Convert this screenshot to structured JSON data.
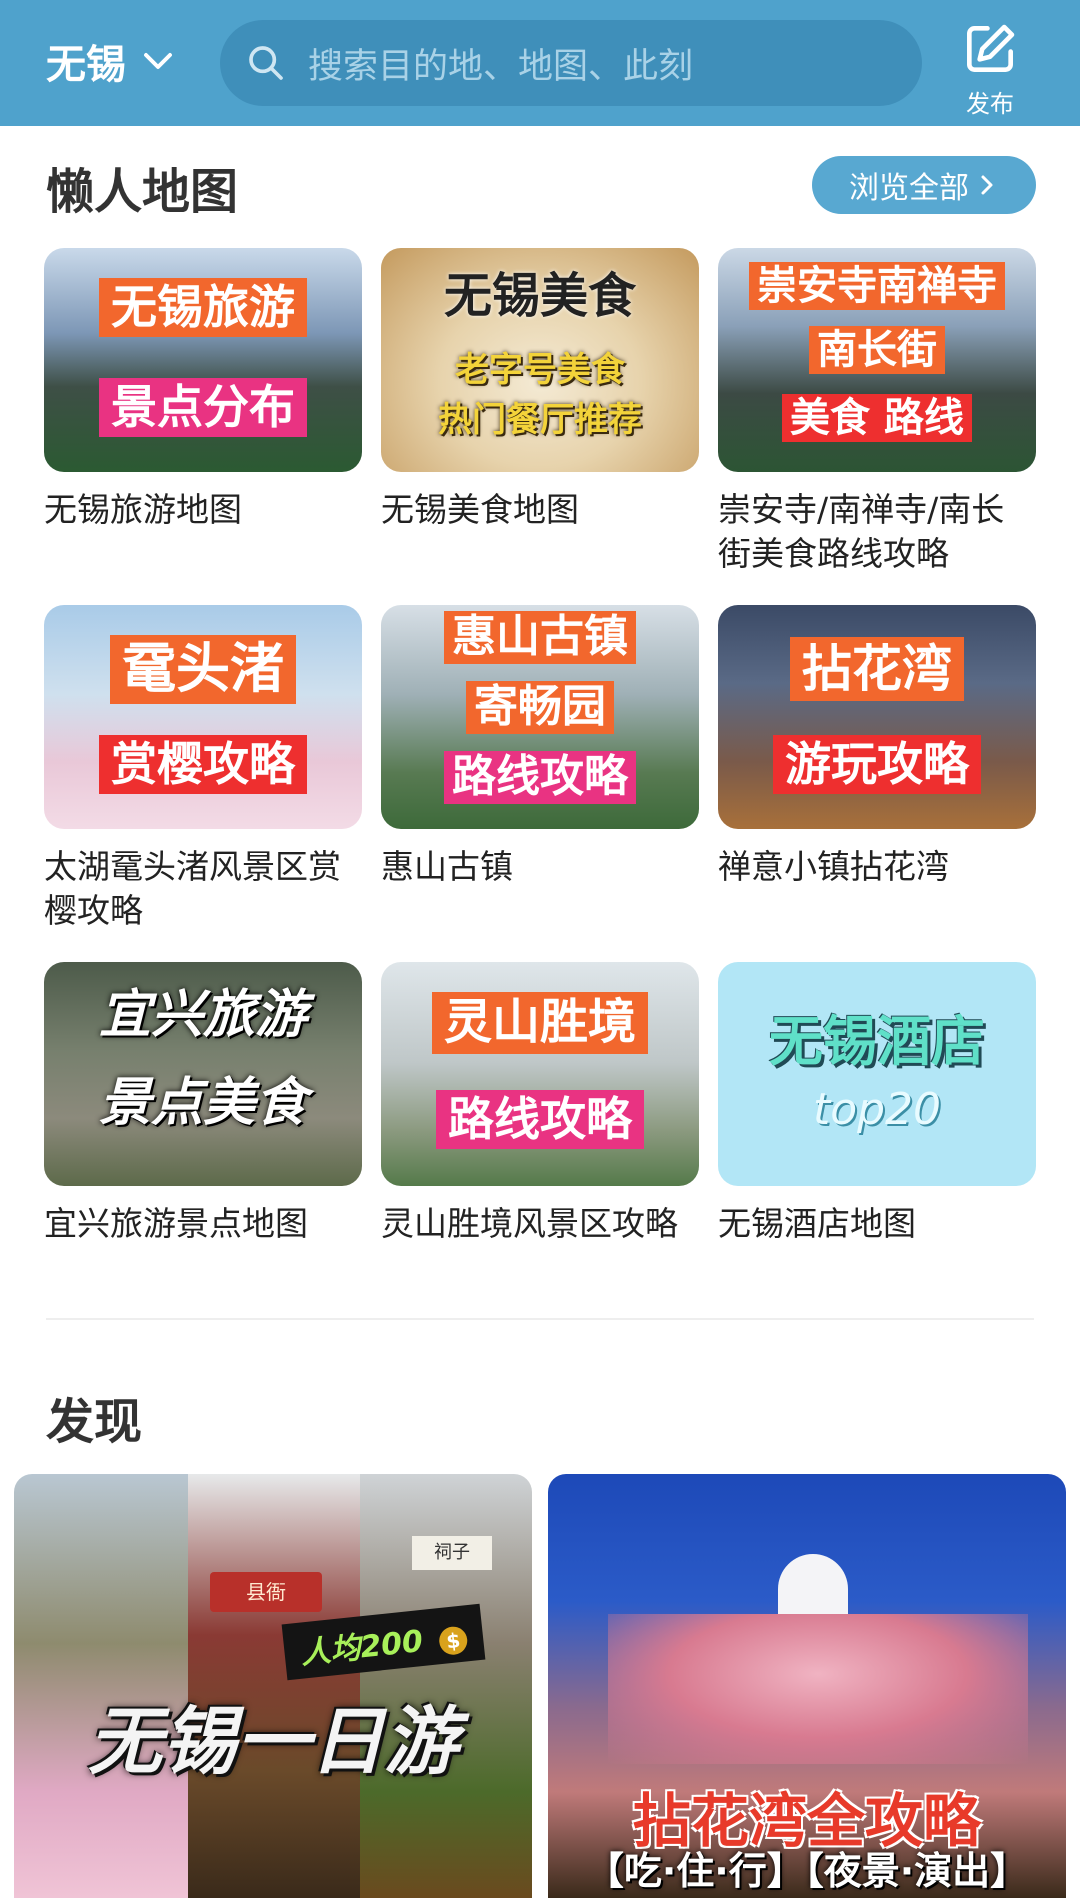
{
  "header": {
    "city": "无锡",
    "search_placeholder": "搜索目的地、地图、此刻",
    "publish_label": "发布"
  },
  "lazy_map": {
    "title": "懒人地图",
    "browse_all_label": "浏览全部",
    "items": [
      {
        "name": "无锡旅游地图",
        "tags": [
          "无锡旅游",
          "景点分布"
        ]
      },
      {
        "name": "无锡美食地图",
        "tags": [
          "无锡美食",
          "老字号美食",
          "热门餐厅推荐"
        ]
      },
      {
        "name": "崇安寺/南禅寺/南长街美食路线攻略",
        "tags": [
          "崇安寺南禅寺",
          "南长街",
          "美食 路线"
        ]
      },
      {
        "name": "太湖鼋头渚风景区赏樱攻略",
        "tags": [
          "鼋头渚",
          "赏樱攻略"
        ]
      },
      {
        "name": "惠山古镇",
        "tags": [
          "惠山古镇",
          "寄畅园",
          "路线攻略"
        ]
      },
      {
        "name": "禅意小镇拈花湾",
        "tags": [
          "拈花湾",
          "游玩攻略"
        ]
      },
      {
        "name": "宜兴旅游景点地图",
        "tags": [
          "宜兴旅游",
          "景点美食"
        ]
      },
      {
        "name": "灵山胜境风景区攻略",
        "tags": [
          "灵山胜境",
          "路线攻略"
        ]
      },
      {
        "name": "无锡酒店地图",
        "tags": [
          "无锡酒店",
          "top20"
        ]
      }
    ]
  },
  "discover": {
    "title": "发现",
    "cards": [
      {
        "badge": "人均200",
        "headline": "无锡一日游",
        "sign_a": "县衙",
        "sign_b": "祠子"
      },
      {
        "headline": "拈花湾全攻略",
        "subline": "【吃·住·行】【夜景·演出】"
      }
    ]
  }
}
